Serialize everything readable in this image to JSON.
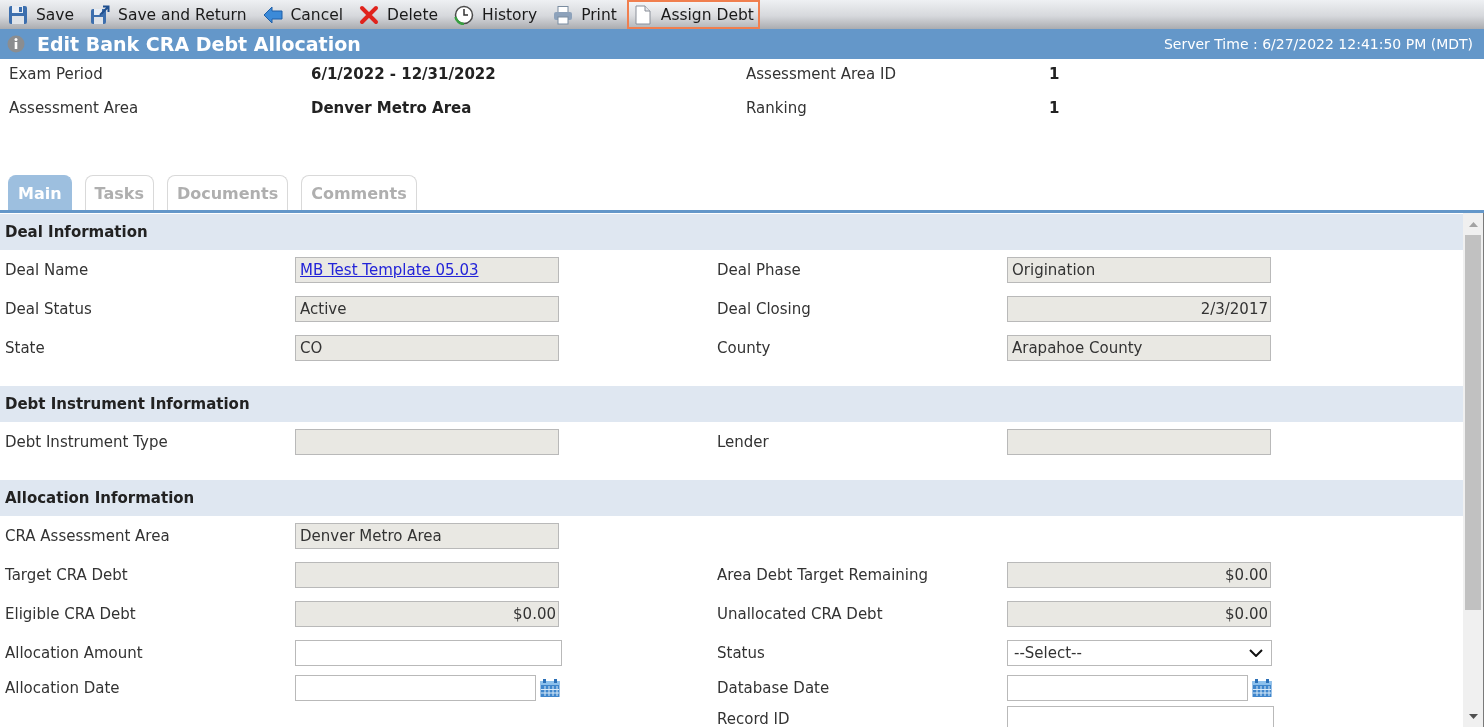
{
  "toolbar": [
    {
      "kind": "save",
      "label": "Save",
      "highlighted": false
    },
    {
      "kind": "return",
      "label": "Save and Return",
      "highlighted": false
    },
    {
      "kind": "cancel",
      "label": "Cancel",
      "highlighted": false
    },
    {
      "kind": "delete",
      "label": "Delete",
      "highlighted": false
    },
    {
      "kind": "history",
      "label": "History",
      "highlighted": false
    },
    {
      "kind": "print",
      "label": "Print",
      "highlighted": false
    },
    {
      "kind": "assign",
      "label": "Assign Debt",
      "highlighted": true
    }
  ],
  "title_bar": {
    "title": "Edit Bank CRA Debt Allocation",
    "server_time": "Server Time : 6/27/2022 12:41:50 PM (MDT)"
  },
  "summary": [
    {
      "label": "Exam Period",
      "value": "6/1/2022 - 12/31/2022"
    },
    {
      "label": "Assessment Area ID",
      "value": "1"
    },
    {
      "label": "Assessment Area",
      "value": "Denver Metro Area"
    },
    {
      "label": "Ranking",
      "value": "1"
    }
  ],
  "tabs": [
    {
      "label": "Main",
      "selected": true
    },
    {
      "label": "Tasks",
      "selected": false
    },
    {
      "label": "Documents",
      "selected": false
    },
    {
      "label": "Comments",
      "selected": false
    }
  ],
  "sections": [
    {
      "title": "Deal Information",
      "rows": [
        {
          "left": {
            "label": "Deal Name",
            "kind": "link",
            "value": "MB Test Template 05.03"
          },
          "right": {
            "label": "Deal Phase",
            "kind": "readonly",
            "value": "Origination"
          }
        },
        {
          "left": {
            "label": "Deal Status",
            "kind": "readonly",
            "value": "Active"
          },
          "right": {
            "label": "Deal Closing",
            "kind": "numeric",
            "value": "2/3/2017"
          }
        },
        {
          "left": {
            "label": "State",
            "kind": "readonly",
            "value": "CO"
          },
          "right": {
            "label": "County",
            "kind": "readonly",
            "value": "Arapahoe County"
          }
        }
      ]
    },
    {
      "title": "Debt Instrument Information",
      "rows": [
        {
          "left": {
            "label": "Debt Instrument Type",
            "kind": "readonly"
          },
          "right": {
            "label": "Lender",
            "kind": "readonly"
          }
        }
      ]
    },
    {
      "title": "Allocation Information",
      "rows": [
        {
          "left": {
            "label": "CRA Assessment Area",
            "kind": "readonly",
            "value": "Denver Metro Area"
          }
        },
        {
          "left": {
            "label": "Target CRA Debt",
            "kind": "readonly"
          },
          "right": {
            "label": "Area Debt Target Remaining",
            "kind": "numeric",
            "value": "$0.00"
          }
        },
        {
          "left": {
            "label": "Eligible CRA Debt",
            "kind": "numeric",
            "value": "$0.00"
          },
          "right": {
            "label": "Unallocated CRA Debt",
            "kind": "numeric",
            "value": "$0.00"
          }
        },
        {
          "left": {
            "label": "Allocation Amount",
            "kind": "input"
          },
          "right": {
            "label": "Status",
            "kind": "select",
            "value": "--Select--"
          }
        },
        {
          "left": {
            "label": "Allocation Date",
            "kind": "date"
          },
          "right": {
            "label": "Database Date",
            "kind": "date"
          }
        },
        {
          "right": {
            "label": "Record ID",
            "kind": "input"
          }
        }
      ]
    }
  ]
}
